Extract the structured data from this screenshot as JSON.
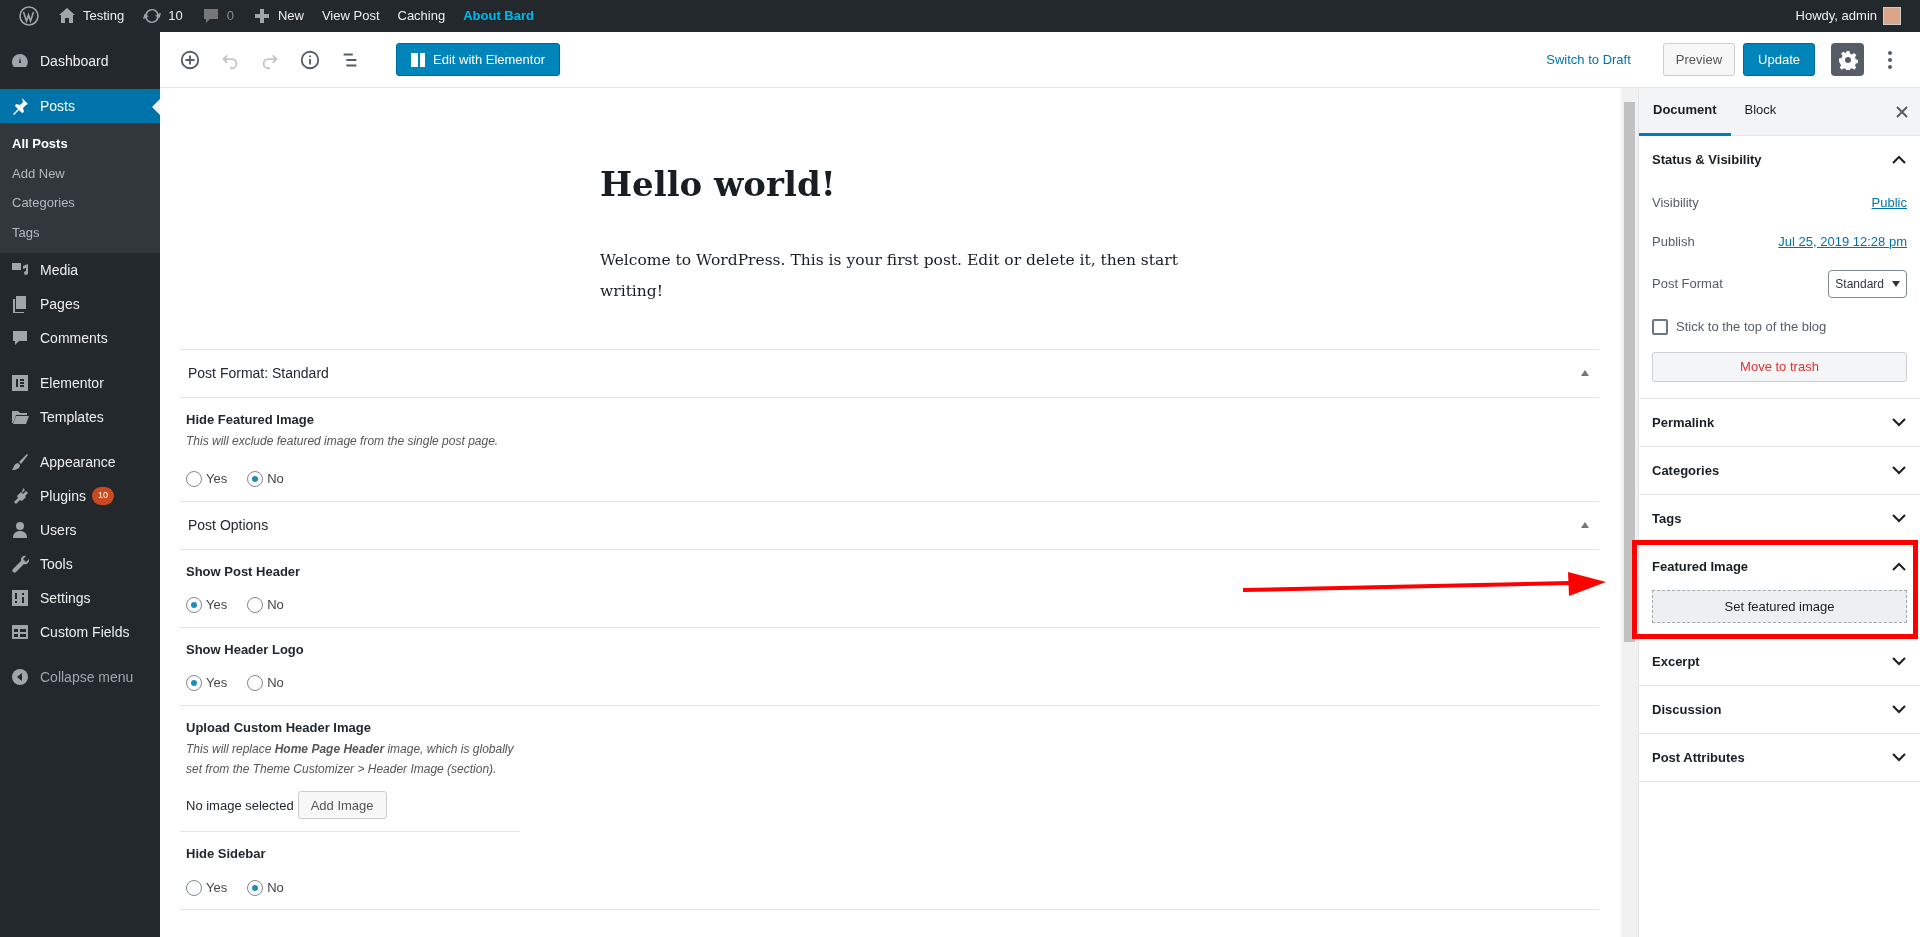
{
  "admin_bar": {
    "items": [
      {
        "label": "Testing",
        "highlighted": false,
        "dimmed": false
      },
      {
        "label": "10",
        "highlighted": false,
        "dimmed": false
      },
      {
        "label": "0",
        "highlighted": false,
        "dimmed": true
      },
      {
        "label": "New",
        "highlighted": false,
        "dimmed": false
      },
      {
        "label": "View Post",
        "highlighted": false,
        "dimmed": false
      },
      {
        "label": "Caching",
        "highlighted": false,
        "dimmed": false
      },
      {
        "label": "About Bard",
        "highlighted": true,
        "dimmed": false
      }
    ],
    "greeting": "Howdy, admin"
  },
  "sidebar": {
    "groups": [
      [
        {
          "label": "Dashboard",
          "selected": false
        }
      ],
      [
        {
          "label": "Posts",
          "selected": true,
          "children": [
            {
              "label": "All Posts",
              "selected": true
            },
            {
              "label": "Add New",
              "selected": false
            },
            {
              "label": "Categories",
              "selected": false
            },
            {
              "label": "Tags",
              "selected": false
            }
          ]
        },
        {
          "label": "Media",
          "selected": false
        },
        {
          "label": "Pages",
          "selected": false
        },
        {
          "label": "Comments",
          "selected": false
        }
      ],
      [
        {
          "label": "Elementor",
          "selected": false
        },
        {
          "label": "Templates",
          "selected": false
        }
      ],
      [
        {
          "label": "Appearance",
          "selected": false
        },
        {
          "label": "Plugins",
          "selected": false,
          "badge": "10"
        },
        {
          "label": "Users",
          "selected": false
        },
        {
          "label": "Tools",
          "selected": false
        },
        {
          "label": "Settings",
          "selected": false
        },
        {
          "label": "Custom Fields",
          "selected": false
        }
      ]
    ],
    "collapse": "Collapse menu"
  },
  "toolbar": {
    "tools": [
      {
        "disabled": false
      },
      {
        "disabled": true
      },
      {
        "disabled": true
      },
      {
        "disabled": false
      },
      {
        "disabled": false
      }
    ],
    "edit_button": "Edit with Elementor",
    "switch_link": "Switch to Draft",
    "preview": "Preview",
    "update": "Update",
    "settings_selected": true
  },
  "post": {
    "title": "Hello world!",
    "body": "Welcome to WordPress. This is your first post. Edit or delete it, then start writing!"
  },
  "meta_boxes": [
    {
      "title": "Post Format: Standard",
      "fields": [
        {
          "kind": "radio",
          "label": "Hide Featured Image",
          "description": "This will exclude featured image from the single post page.",
          "options": [
            {
              "label": "Yes",
              "selected": false
            },
            {
              "label": "No",
              "selected": true
            }
          ]
        }
      ]
    },
    {
      "title": "Post Options",
      "fields": [
        {
          "kind": "radio",
          "label": "Show Post Header",
          "options": [
            {
              "label": "Yes",
              "selected": true
            },
            {
              "label": "No",
              "selected": false
            }
          ]
        },
        {
          "kind": "radio",
          "label": "Show Header Logo",
          "options": [
            {
              "label": "Yes",
              "selected": true
            },
            {
              "label": "No",
              "selected": false
            }
          ]
        },
        {
          "kind": "upload",
          "label": "Upload Custom Header Image",
          "description": "This will replace **Home Page Header** image, which is globally set from the Theme Customizer > Header Image (section).",
          "status": "No image selected",
          "button": "Add Image"
        },
        {
          "kind": "radio",
          "label": "Hide Sidebar",
          "options": [
            {
              "label": "Yes",
              "selected": false
            },
            {
              "label": "No",
              "selected": true
            }
          ]
        }
      ]
    }
  ],
  "panel": {
    "tabs": [
      {
        "label": "Document",
        "selected": true
      },
      {
        "label": "Block",
        "selected": false
      }
    ],
    "sections": [
      {
        "title": "Status & Visibility",
        "expanded": true,
        "rows": [
          {
            "kind": "link",
            "label": "Visibility",
            "value": "Public"
          },
          {
            "kind": "link",
            "label": "Publish",
            "value": "Jul 25, 2019 12:28 pm"
          },
          {
            "kind": "select",
            "label": "Post Format",
            "value": "Standard"
          },
          {
            "kind": "checkbox",
            "label": "Stick to the top of the blog",
            "checked": false
          },
          {
            "kind": "danger_button",
            "label": "Move to trash"
          }
        ]
      },
      {
        "title": "Permalink",
        "expanded": false
      },
      {
        "title": "Categories",
        "expanded": false
      },
      {
        "title": "Tags",
        "expanded": false
      },
      {
        "title": "Featured Image",
        "expanded": true,
        "rows": [
          {
            "kind": "dashed_button",
            "label": "Set featured image"
          }
        ]
      },
      {
        "title": "Excerpt",
        "expanded": false
      },
      {
        "title": "Discussion",
        "expanded": false
      },
      {
        "title": "Post Attributes",
        "expanded": false
      }
    ]
  }
}
